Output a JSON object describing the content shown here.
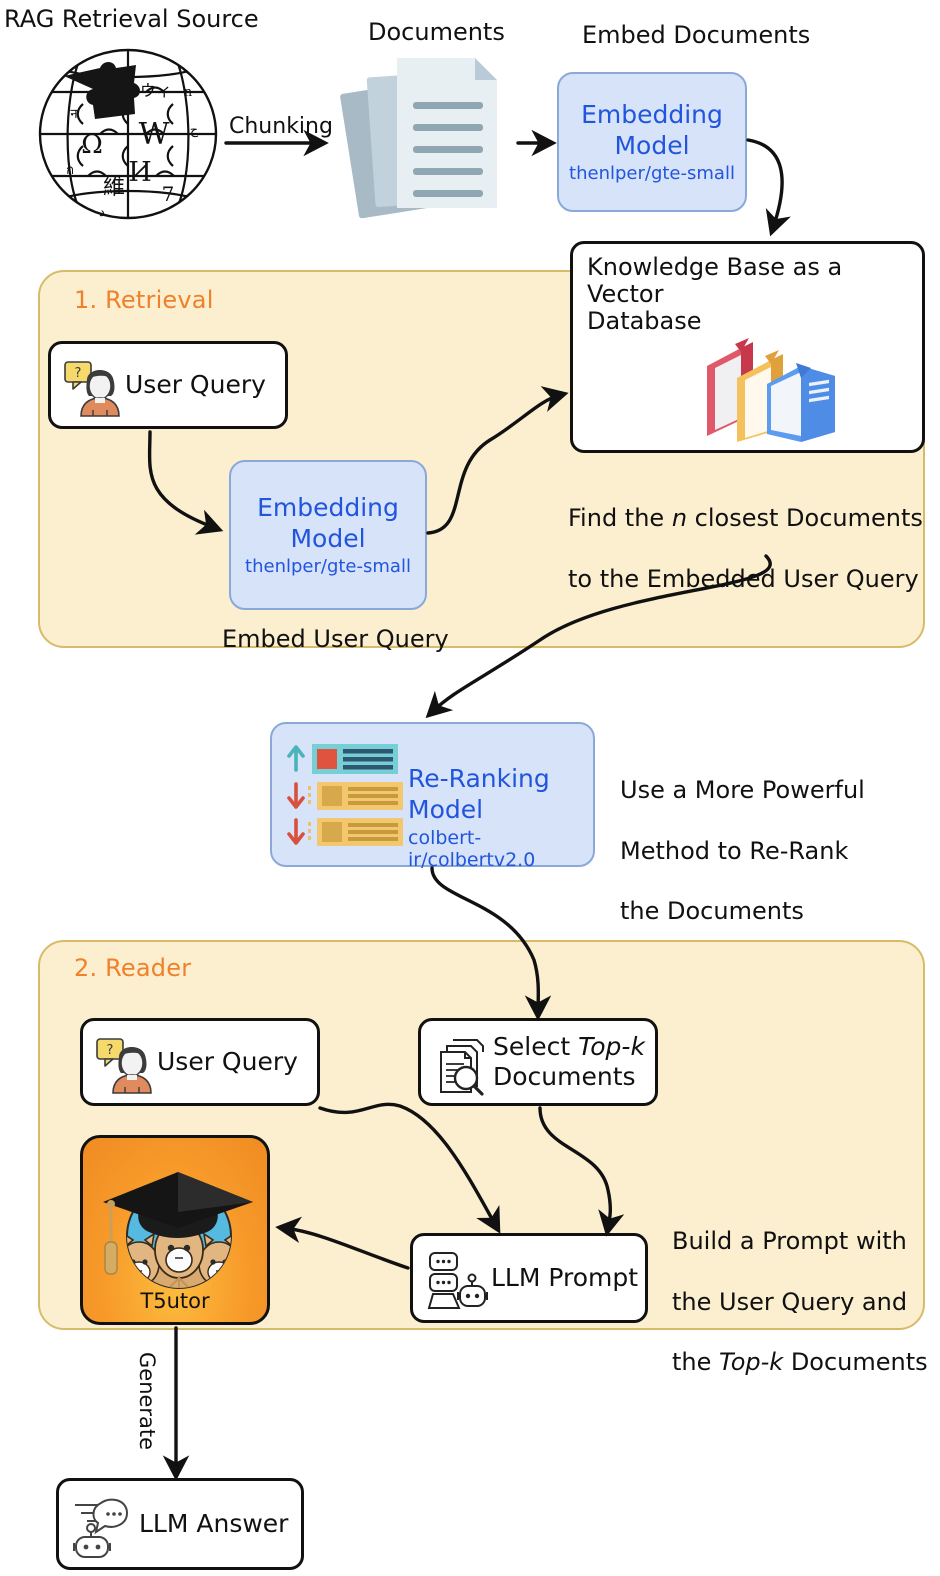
{
  "diagram": {
    "title": "RAG pipeline with retrieval and reader stages",
    "colors": {
      "panel_bg": "#fbefd0",
      "panel_border": "#d8bb68",
      "panel_title": "#f0802a",
      "model_box_bg": "#d6e3f8",
      "model_box_border": "#8aa9d8",
      "model_text": "#2255dd",
      "t5utor_bg": "#f79a2a",
      "node_border": "#111111"
    }
  },
  "top": {
    "source_label": "RAG Retrieval Source",
    "source_icon": "wikipedia-globe-icon",
    "chunking_label": "Chunking",
    "documents_label": "Documents",
    "documents_icon": "documents-stack-icon",
    "embed_documents_label": "Embed Documents",
    "embedding_model": {
      "line1": "Embedding",
      "line2": "Model",
      "model_id": "thenlper/gte-small"
    },
    "knowledge_base": {
      "line1": "Knowledge Base as a Vector",
      "line2": "Database",
      "icon": "books-stack-icon"
    }
  },
  "retrieval": {
    "title": "1. Retrieval",
    "user_query_label": "User Query",
    "user_query_icon": "user-question-icon",
    "embedding_model": {
      "line1": "Embedding",
      "line2": "Model",
      "model_id": "thenlper/gte-small"
    },
    "embed_user_query_label": "Embed User Query",
    "find_note_line1_a": "Find the ",
    "find_note_line1_i": "n",
    "find_note_line1_b": " closest Documents",
    "find_note_line2": "to the Embedded User Query"
  },
  "rerank": {
    "title": "Re-Ranking Model",
    "model_id": "colbert-ir/colbertv2.0",
    "icon": "ranked-list-icon",
    "note_line1": "Use a More Powerful",
    "note_line2": "Method to Re-Rank",
    "note_line3": "the Documents"
  },
  "reader": {
    "title": "2. Reader",
    "user_query_label": "User Query",
    "user_query_icon": "user-question-icon",
    "select_topk": {
      "line1_a": "Select ",
      "line1_i": "Top-k",
      "line2": "Documents",
      "icon": "documents-search-icon"
    },
    "llm_prompt_label": "LLM Prompt",
    "llm_prompt_icon": "chatbot-laptop-icon",
    "t5utor_label": "T5utor",
    "t5utor_icon": "graduation-alpaca-icon",
    "build_note_line1": "Build a Prompt with",
    "build_note_line2": "the User Query and",
    "build_note_line3_a": "the ",
    "build_note_line3_i": "Top-k",
    "build_note_line3_b": " Documents"
  },
  "output": {
    "generate_label": "Generate",
    "llm_answer_label": "LLM Answer",
    "llm_answer_icon": "chatbot-answer-icon"
  }
}
